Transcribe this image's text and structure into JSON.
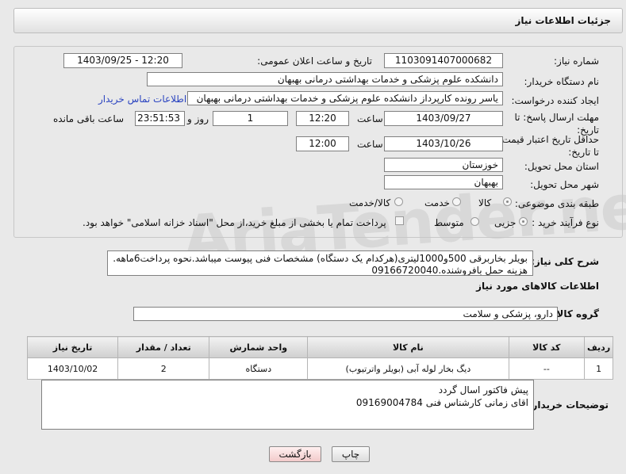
{
  "header": {
    "title": "جزئیات اطلاعات نیاز"
  },
  "form": {
    "need_number_label": "شماره نیاز:",
    "need_number": "1103091407000682",
    "announce_label": "تاریخ و ساعت اعلان عمومی:",
    "announce_value": "1403/09/25 - 12:20",
    "buyer_org_label": "نام دستگاه خریدار:",
    "buyer_org": "دانشکده علوم پزشکی و خدمات بهداشتی  درمانی بهبهان",
    "creator_label": "ایجاد کننده درخواست:",
    "creator": "یاسر رونده کارپرداز دانشکده علوم پزشکی و خدمات بهداشتی  درمانی بهبهان",
    "contact_link": "اطلاعات تماس خریدار",
    "reply_deadline_label": "مهلت ارسال پاسخ: تا تاریخ:",
    "reply_date": "1403/09/27",
    "time_label": "ساعت",
    "reply_time": "12:20",
    "days_value": "1",
    "days_label": "روز و",
    "remaining_time": "23:51:53",
    "remaining_label": "ساعت باقی مانده",
    "validity_label": "حداقل تاریخ اعتبار قیمت: تا تاریخ:",
    "validity_date": "1403/10/26",
    "validity_time": "12:00",
    "province_label": "استان محل تحویل:",
    "province": "خوزستان",
    "city_label": "شهر محل تحویل:",
    "city": "بهبهان",
    "category_label": "طبقه بندی موضوعی:",
    "category_options": [
      "کالا",
      "خدمت",
      "کالا/خدمت"
    ],
    "process_label": "نوع فرآیند خرید :",
    "process_options": [
      "جزیی",
      "متوسط"
    ],
    "payment_note": "پرداخت تمام یا بخشی از مبلغ خرید،از محل \"اسناد خزانه اسلامی\" خواهد بود."
  },
  "description": {
    "label": "شرح کلی نیاز:",
    "text": "بویلر بخاربرقی 500و1000لیتری(هرکدام یک دستگاه) مشخصات فنی پیوست میباشد.نحوه پرداخت6ماهه. هزینه حمل بافروشنده.09166720040"
  },
  "goods": {
    "section_title": "اطلاعات کالاهای مورد نیاز",
    "group_label": "گروه کالا:",
    "group_value": "دارو، پزشکی و سلامت",
    "columns": [
      "ردیف",
      "کد کالا",
      "نام کالا",
      "واحد شمارش",
      "تعداد / مقدار",
      "تاریخ نیاز"
    ],
    "rows": [
      {
        "row": "1",
        "code": "--",
        "name": "دیگ بخار لوله آبی (بویلر واترتیوب)",
        "unit": "دستگاه",
        "qty": "2",
        "date": "1403/10/02"
      }
    ]
  },
  "buyer_notes": {
    "label": "توضیحات خریدار:",
    "line1": "پیش فاکتور اسال گردد",
    "line2": "اقای زمانی کارشناس فنی 09169004784"
  },
  "buttons": {
    "print": "چاپ",
    "back": "بازگشت"
  },
  "watermark": "AriaTender.neT"
}
